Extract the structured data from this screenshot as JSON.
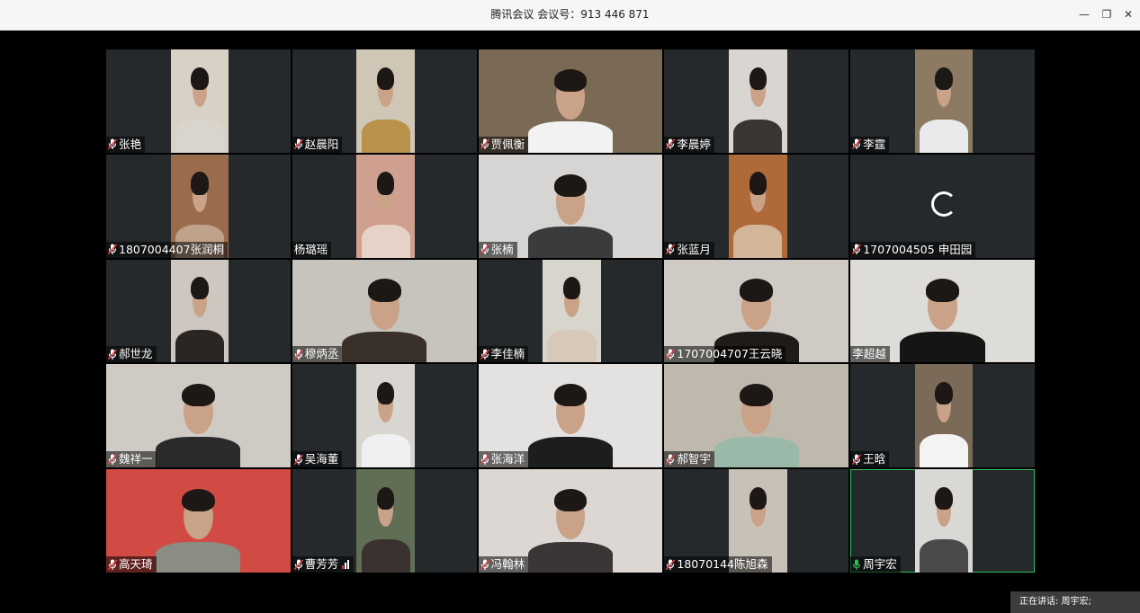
{
  "window": {
    "title": "腾讯会议 会议号：913 446 871",
    "minimize_icon": "minimize-icon",
    "restore_icon": "restore-icon",
    "close_icon": "close-icon",
    "minimize_glyph": "—",
    "restore_glyph": "❐",
    "close_glyph": "✕"
  },
  "colors": {
    "active_speaker_border": "#2fbf5a",
    "mic_muted": "#e0424a",
    "mic_active": "#2fbf5a"
  },
  "participants": [
    {
      "name": "张艳",
      "mic": "muted",
      "video": "portrait",
      "bg": "#d8d2c6",
      "shirt": "#d9d4cc"
    },
    {
      "name": "赵晨阳",
      "mic": "muted",
      "video": "portrait",
      "bg": "#cfc6b6",
      "shirt": "#b8924a"
    },
    {
      "name": "贾佩衡",
      "mic": "muted",
      "video": "full",
      "bg": "#7a6a55",
      "shirt": "#f2f2f2"
    },
    {
      "name": "李晨婷",
      "mic": "muted",
      "video": "portrait",
      "bg": "#d9d6d2",
      "shirt": "#3a3533"
    },
    {
      "name": "李霆",
      "mic": "muted",
      "video": "portrait",
      "bg": "#8c7a62",
      "shirt": "#e8eaec"
    },
    {
      "name": "1807004407张润桐",
      "mic": "muted",
      "video": "portrait",
      "bg": "#9a6c4c",
      "shirt": "#c0a18a"
    },
    {
      "name": "杨璐瑶",
      "mic": "none",
      "video": "portrait",
      "bg": "#cf9f8f",
      "shirt": "#e6d2c6"
    },
    {
      "name": "张楠",
      "mic": "muted",
      "video": "full",
      "bg": "#d7d5d3",
      "shirt": "#3b3a3c"
    },
    {
      "name": "张蓝月",
      "mic": "muted",
      "video": "portrait",
      "bg": "#b06a3a",
      "shirt": "#d3b59a"
    },
    {
      "name": "1707004505 申田园",
      "mic": "muted",
      "video": "none",
      "bg": "#26292c",
      "shirt": "#26292c"
    },
    {
      "name": "郝世龙",
      "mic": "muted",
      "video": "portrait",
      "bg": "#cdc7bf",
      "shirt": "#2a2624"
    },
    {
      "name": "穆炳丞",
      "mic": "muted",
      "video": "full",
      "bg": "#c7c4bd",
      "shirt": "#3a302a"
    },
    {
      "name": "李佳楠",
      "mic": "muted",
      "video": "portrait",
      "bg": "#d8d5cd",
      "shirt": "#d7c8b9"
    },
    {
      "name": "1707004707王云晓",
      "mic": "muted",
      "video": "full",
      "bg": "#cfcac3",
      "shirt": "#1f1b19"
    },
    {
      "name": "李超越",
      "mic": "none",
      "video": "full",
      "bg": "#dedcd8",
      "shirt": "#151515"
    },
    {
      "name": "魏祥一",
      "mic": "muted",
      "video": "full",
      "bg": "#cfcac4",
      "shirt": "#2a2a2a"
    },
    {
      "name": "吴海董",
      "mic": "muted",
      "video": "portrait",
      "bg": "#d9d6d1",
      "shirt": "#f0f0f0"
    },
    {
      "name": "张海洋",
      "mic": "muted",
      "video": "full",
      "bg": "#e4e2e0",
      "shirt": "#1d1d1d"
    },
    {
      "name": "郝智宇",
      "mic": "muted",
      "video": "full",
      "bg": "#bfb8ad",
      "shirt": "#9ab9a8"
    },
    {
      "name": "王晗",
      "mic": "muted",
      "video": "portrait",
      "bg": "#7a6a57",
      "shirt": "#f3f3f3"
    },
    {
      "name": "高天琦",
      "mic": "muted",
      "video": "full",
      "bg": "#d24a44",
      "shirt": "#8a8d83"
    },
    {
      "name": "曹芳芳",
      "mic": "muted",
      "video": "portrait",
      "bg": "#5f6e55",
      "shirt": "#3a3230",
      "signal": true
    },
    {
      "name": "冯翰林",
      "mic": "muted",
      "video": "full",
      "bg": "#dcd7d2",
      "shirt": "#3a3636"
    },
    {
      "name": "18070144陈旭森",
      "mic": "muted",
      "video": "portrait",
      "bg": "#c8c1b8",
      "shirt": "#c8c1b8"
    },
    {
      "name": "周宇宏",
      "mic": "active",
      "video": "portrait",
      "bg": "#d9d8d5",
      "shirt": "#4a4a4a",
      "active": true
    }
  ],
  "status": {
    "speaking_text": "正在讲话: 周宇宏;"
  }
}
